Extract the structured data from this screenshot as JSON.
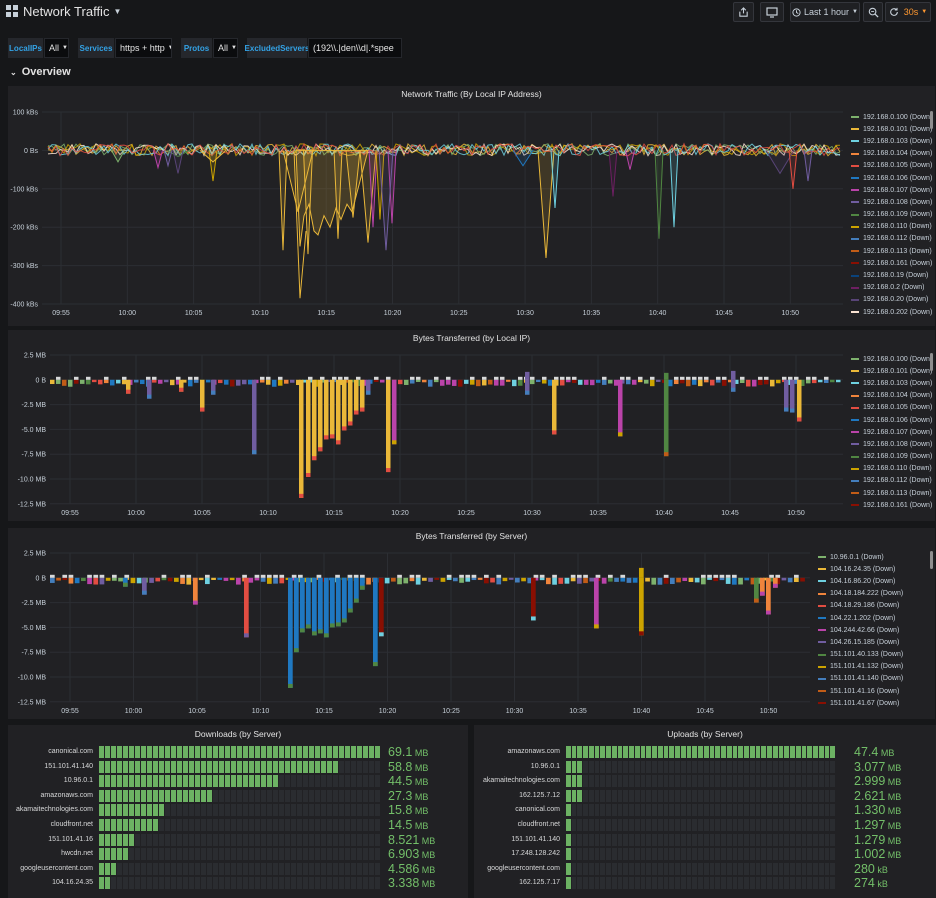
{
  "header": {
    "title": "Network Traffic",
    "time_range": "Last 1 hour",
    "refresh": "30s"
  },
  "variables": [
    {
      "label": "LocalIPs",
      "value": "All"
    },
    {
      "label": "Services",
      "value": "https + http"
    },
    {
      "label": "Protos",
      "value": "All"
    },
    {
      "label": "ExcludedServers",
      "value": "(192\\\\.|den\\\\d|.*spee"
    }
  ],
  "row_title": "Overview",
  "colors": {
    "background": "#161719",
    "panel": "#212124",
    "gauge_green": "#73bf69",
    "accent_blue": "#33a2e5",
    "refresh_orange": "#ff9830"
  },
  "icons": [
    "apps-icon",
    "share-icon",
    "monitor-icon",
    "clock-icon",
    "zoom-out-icon",
    "refresh-icon"
  ],
  "x_ticks": [
    "09:55",
    "10:00",
    "10:05",
    "10:10",
    "10:15",
    "10:20",
    "10:25",
    "10:30",
    "10:35",
    "10:40",
    "10:45",
    "10:50"
  ],
  "panels": {
    "traffic": {
      "title": "Network Traffic (By Local IP Address)",
      "y_ticks": [
        "100 kBs",
        "0 Bs",
        "-100 kBs",
        "-200 kBs",
        "-300 kBs",
        "-400 kBs"
      ],
      "legend": [
        {
          "name": "192.168.0.100 (Down)",
          "color": "#7eb26d"
        },
        {
          "name": "192.168.0.101 (Down)",
          "color": "#eab839"
        },
        {
          "name": "192.168.0.103 (Down)",
          "color": "#6ed0e0"
        },
        {
          "name": "192.168.0.104 (Down)",
          "color": "#ef843c"
        },
        {
          "name": "192.168.0.105 (Down)",
          "color": "#e24d42"
        },
        {
          "name": "192.168.0.106 (Down)",
          "color": "#1f78c1"
        },
        {
          "name": "192.168.0.107 (Down)",
          "color": "#ba43a9"
        },
        {
          "name": "192.168.0.108 (Down)",
          "color": "#705da0"
        },
        {
          "name": "192.168.0.109 (Down)",
          "color": "#508642"
        },
        {
          "name": "192.168.0.110 (Down)",
          "color": "#cca300"
        },
        {
          "name": "192.168.0.112 (Down)",
          "color": "#447ebc"
        },
        {
          "name": "192.168.0.113 (Down)",
          "color": "#c15c17"
        },
        {
          "name": "192.168.0.161 (Down)",
          "color": "#890f02"
        },
        {
          "name": "192.168.0.19 (Down)",
          "color": "#0a437c"
        },
        {
          "name": "192.168.0.2 (Down)",
          "color": "#6d1f62"
        },
        {
          "name": "192.168.0.20 (Down)",
          "color": "#584477"
        },
        {
          "name": "192.168.0.202 (Down)",
          "color": "#f9e2d2"
        }
      ]
    },
    "bytes_ip": {
      "title": "Bytes Transferred (by Local IP)",
      "y_ticks": [
        "2.5 MB",
        "0 B",
        "-2.5 MB",
        "-5.0 MB",
        "-7.5 MB",
        "-10.0 MB",
        "-12.5 MB"
      ],
      "legend": [
        {
          "name": "192.168.0.100 (Down)",
          "color": "#7eb26d"
        },
        {
          "name": "192.168.0.101 (Down)",
          "color": "#eab839"
        },
        {
          "name": "192.168.0.103 (Down)",
          "color": "#6ed0e0"
        },
        {
          "name": "192.168.0.104 (Down)",
          "color": "#ef843c"
        },
        {
          "name": "192.168.0.105 (Down)",
          "color": "#e24d42"
        },
        {
          "name": "192.168.0.106 (Down)",
          "color": "#1f78c1"
        },
        {
          "name": "192.168.0.107 (Down)",
          "color": "#ba43a9"
        },
        {
          "name": "192.168.0.108 (Down)",
          "color": "#705da0"
        },
        {
          "name": "192.168.0.109 (Down)",
          "color": "#508642"
        },
        {
          "name": "192.168.0.110 (Down)",
          "color": "#cca300"
        },
        {
          "name": "192.168.0.112 (Down)",
          "color": "#447ebc"
        },
        {
          "name": "192.168.0.113 (Down)",
          "color": "#c15c17"
        },
        {
          "name": "192.168.0.161 (Down)",
          "color": "#890f02"
        }
      ]
    },
    "bytes_server": {
      "title": "Bytes Transferred (by Server)",
      "y_ticks": [
        "2.5 MB",
        "0 B",
        "-2.5 MB",
        "-5.0 MB",
        "-7.5 MB",
        "-10.0 MB",
        "-12.5 MB"
      ],
      "legend": [
        {
          "name": "10.96.0.1 (Down)",
          "color": "#7eb26d"
        },
        {
          "name": "104.16.24.35 (Down)",
          "color": "#eab839"
        },
        {
          "name": "104.16.86.20 (Down)",
          "color": "#6ed0e0"
        },
        {
          "name": "104.18.184.222 (Down)",
          "color": "#ef843c"
        },
        {
          "name": "104.18.29.186 (Down)",
          "color": "#e24d42"
        },
        {
          "name": "104.22.1.202 (Down)",
          "color": "#1f78c1"
        },
        {
          "name": "104.244.42.66 (Down)",
          "color": "#ba43a9"
        },
        {
          "name": "104.26.15.185 (Down)",
          "color": "#705da0"
        },
        {
          "name": "151.101.40.133 (Down)",
          "color": "#508642"
        },
        {
          "name": "151.101.41.132 (Down)",
          "color": "#cca300"
        },
        {
          "name": "151.101.41.140 (Down)",
          "color": "#447ebc"
        },
        {
          "name": "151.101.41.16 (Down)",
          "color": "#c15c17"
        },
        {
          "name": "151.101.41.67 (Down)",
          "color": "#890f02"
        }
      ]
    },
    "downloads": {
      "title": "Downloads (by Server)",
      "items": [
        {
          "name": "canonical.com",
          "value": "69.1",
          "unit": "MB",
          "fraction": 1.0
        },
        {
          "name": "151.101.41.140",
          "value": "58.8",
          "unit": "MB",
          "fraction": 0.85
        },
        {
          "name": "10.96.0.1",
          "value": "44.5",
          "unit": "MB",
          "fraction": 0.644
        },
        {
          "name": "amazonaws.com",
          "value": "27.3",
          "unit": "MB",
          "fraction": 0.395
        },
        {
          "name": "akamaitechnologies.com",
          "value": "15.8",
          "unit": "MB",
          "fraction": 0.229
        },
        {
          "name": "cloudfront.net",
          "value": "14.5",
          "unit": "MB",
          "fraction": 0.21
        },
        {
          "name": "151.101.41.16",
          "value": "8.521",
          "unit": "MB",
          "fraction": 0.123
        },
        {
          "name": "hwcdn.net",
          "value": "6.903",
          "unit": "MB",
          "fraction": 0.1
        },
        {
          "name": "googleusercontent.com",
          "value": "4.586",
          "unit": "MB",
          "fraction": 0.066
        },
        {
          "name": "104.16.24.35",
          "value": "3.338",
          "unit": "MB",
          "fraction": 0.048
        }
      ]
    },
    "uploads": {
      "title": "Uploads (by Server)",
      "items": [
        {
          "name": "amazonaws.com",
          "value": "47.4",
          "unit": "MB",
          "fraction": 1.0
        },
        {
          "name": "10.96.0.1",
          "value": "3.077",
          "unit": "MB",
          "fraction": 0.065
        },
        {
          "name": "akamaitechnologies.com",
          "value": "2.999",
          "unit": "MB",
          "fraction": 0.063
        },
        {
          "name": "162.125.7.12",
          "value": "2.621",
          "unit": "MB",
          "fraction": 0.055
        },
        {
          "name": "canonical.com",
          "value": "1.330",
          "unit": "MB",
          "fraction": 0.028
        },
        {
          "name": "cloudfront.net",
          "value": "1.297",
          "unit": "MB",
          "fraction": 0.027
        },
        {
          "name": "151.101.41.140",
          "value": "1.279",
          "unit": "MB",
          "fraction": 0.027
        },
        {
          "name": "17.248.128.242",
          "value": "1.002",
          "unit": "MB",
          "fraction": 0.021
        },
        {
          "name": "googleusercontent.com",
          "value": "280",
          "unit": "kB",
          "fraction": 0.006
        },
        {
          "name": "162.125.7.17",
          "value": "274",
          "unit": "kB",
          "fraction": 0.006
        }
      ]
    }
  }
}
